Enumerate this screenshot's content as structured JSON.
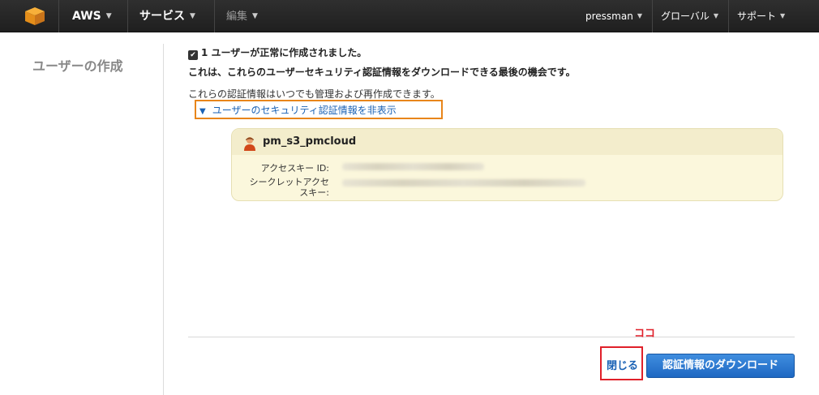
{
  "nav": {
    "brand": "AWS",
    "services": "サービス",
    "edit": "編集",
    "user": "pressman",
    "region": "グローバル",
    "support": "サポート"
  },
  "page": {
    "title": "ユーザーの作成",
    "success_message": "1 ユーザーが正常に作成されました。",
    "last_chance": "これは、これらのユーザーセキュリティ認証情報をダウンロードできる最後の機会です。",
    "info": "これらの認証情報はいつでも管理および再作成できます。",
    "toggle_link": "ユーザーのセキュリティ認証情報を非表示"
  },
  "credentials": {
    "user_name": "pm_s3_pmcloud",
    "access_key_label": "アクセスキー ID:",
    "secret_key_label_1": "シークレットアクセ",
    "secret_key_label_2": "スキー:"
  },
  "annotation": {
    "note": "ココ",
    "color": "#e0202a"
  },
  "actions": {
    "close": "閉じる",
    "download": "認証情報のダウンロード"
  },
  "colors": {
    "accent": "#1a62b5",
    "highlight": "#e8851a"
  }
}
